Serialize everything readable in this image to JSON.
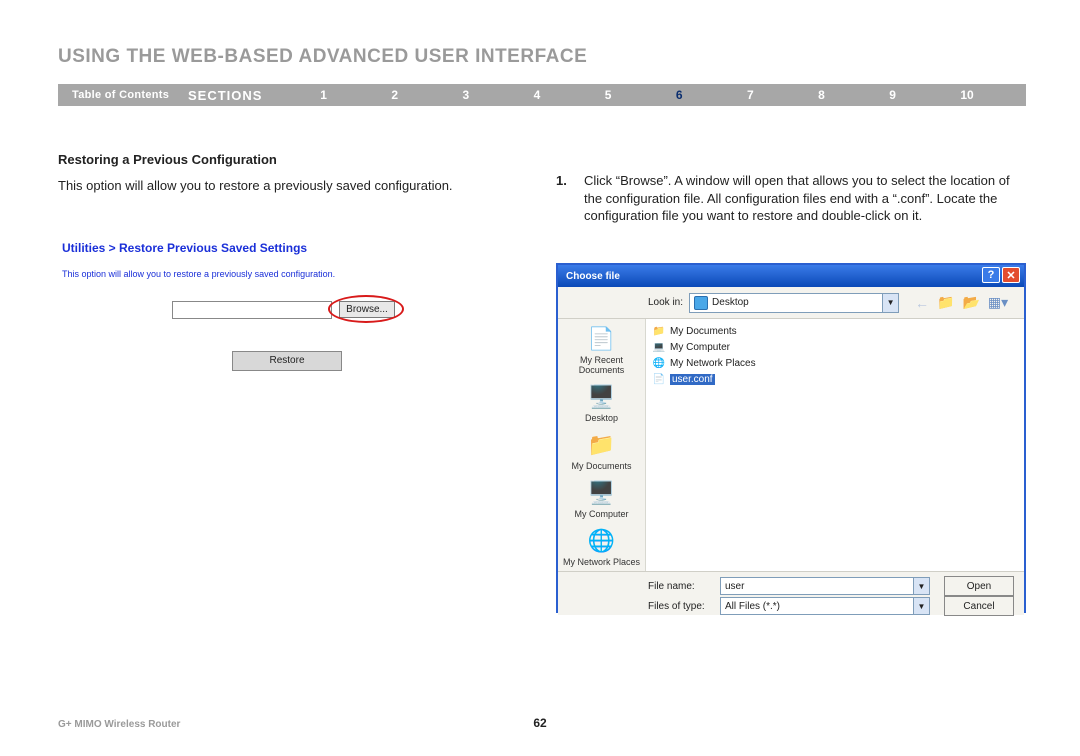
{
  "page_title": "USING THE WEB-BASED ADVANCED USER INTERFACE",
  "nav": {
    "toc": "Table of Contents",
    "sections_label": "SECTIONS",
    "items": [
      "1",
      "2",
      "3",
      "4",
      "5",
      "6",
      "7",
      "8",
      "9",
      "10"
    ],
    "current": "6"
  },
  "left": {
    "subheading": "Restoring a Previous Configuration",
    "body": "This option will allow you to restore a previously saved configuration.",
    "router": {
      "breadcrumb": "Utilities > Restore Previous Saved Settings",
      "desc": "This option will allow you to restore a previously saved configuration.",
      "browse_label": "Browse...",
      "restore_label": "Restore"
    }
  },
  "right": {
    "step_num": "1.",
    "step_text": "Click “Browse”. A window will open that allows you to select the location of the configuration file. All configuration files end with a “.conf”. Locate the configuration file you want to restore and double-click on it."
  },
  "dialog": {
    "title": "Choose file",
    "lookin_label": "Look in:",
    "lookin_value": "Desktop",
    "places": [
      {
        "label": "My Recent Documents",
        "icon": "📄"
      },
      {
        "label": "Desktop",
        "icon": "🖥️"
      },
      {
        "label": "My Documents",
        "icon": "📁"
      },
      {
        "label": "My Computer",
        "icon": "🖥️"
      },
      {
        "label": "My Network Places",
        "icon": "🌐"
      }
    ],
    "files": [
      {
        "icon": "📁",
        "name": "My Documents"
      },
      {
        "icon": "💻",
        "name": "My Computer"
      },
      {
        "icon": "🌐",
        "name": "My Network Places"
      },
      {
        "icon": "📄",
        "name": "user.conf",
        "selected": true
      }
    ],
    "filename_label": "File name:",
    "filename_value": "user",
    "filetype_label": "Files of type:",
    "filetype_value": "All Files (*.*)",
    "open_label": "Open",
    "cancel_label": "Cancel",
    "help_label": "?",
    "close_label": "✕"
  },
  "footer": {
    "product": "G+ MIMO Wireless Router",
    "page": "62"
  }
}
